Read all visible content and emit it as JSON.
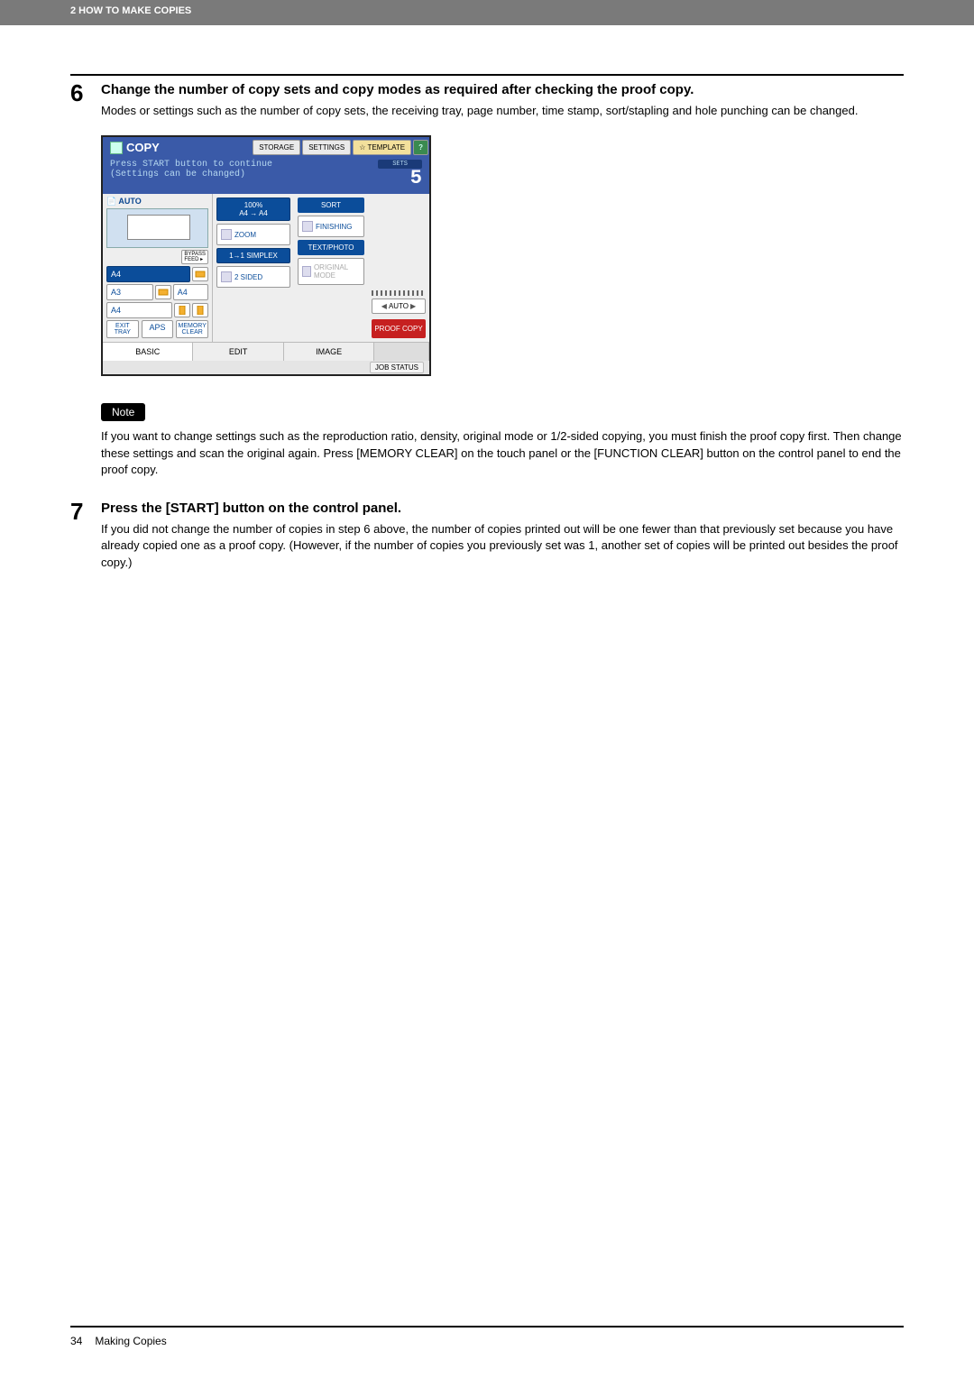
{
  "header": {
    "breadcrumb": "2 HOW TO MAKE COPIES"
  },
  "steps": [
    {
      "num": "6",
      "heading": "Change the number of copy sets and copy modes as required after checking the proof copy.",
      "text": "Modes or settings such as the number of copy sets, the receiving tray, page number, time stamp, sort/stapling and hole punching can be changed."
    },
    {
      "num": "7",
      "heading": "Press the [START] button on the control panel.",
      "text": "If you did not change the number of copies in step 6 above, the number of copies printed out will be one fewer than that previously set because you have already copied one as a proof copy. (However, if the number of copies you previously set was 1, another set of copies will be printed out besides the proof copy.)"
    }
  ],
  "copy_ui": {
    "title": "COPY",
    "top_buttons": {
      "storage": "STORAGE",
      "settings": "SETTINGS",
      "template": "TEMPLATE",
      "help": "?"
    },
    "msg_line1": "Press START button to continue",
    "msg_line2": "(Settings can be changed)",
    "sets_label": "SETS",
    "sets_value": "5",
    "left": {
      "auto": "AUTO",
      "bypass": "BYPASS FEED",
      "trays": [
        {
          "label": "A4",
          "selected": true,
          "orient": "landscape"
        },
        {
          "label": "A3",
          "selected": false,
          "orient": "landscape"
        },
        {
          "label": "A4",
          "selected": false,
          "orient": "portrait"
        }
      ],
      "right_col_label": "A4",
      "exit": "EXIT TRAY",
      "aps": "APS",
      "memory_clear": "MEMORY CLEAR"
    },
    "mid": {
      "ratio": "100%",
      "paper": "A4 → A4",
      "zoom": "ZOOM",
      "simplex": "1→1 SIMPLEX",
      "sided": "2 SIDED"
    },
    "right": {
      "sort": "SORT",
      "finishing": "FINISHING",
      "text_photo": "TEXT/PHOTO",
      "original_mode": "ORIGINAL MODE"
    },
    "far": {
      "auto": "AUTO",
      "proof": "PROOF COPY"
    },
    "tabs": {
      "basic": "BASIC",
      "edit": "EDIT",
      "image": "IMAGE"
    },
    "job_status": "JOB STATUS"
  },
  "note": {
    "badge": "Note",
    "text": "If you want to change settings such as the reproduction ratio, density, original mode or 1/2-sided copying, you must finish the proof copy first. Then change these settings and scan the original again. Press [MEMORY CLEAR] on the touch panel or the [FUNCTION CLEAR] button on the control panel to end the proof copy."
  },
  "footer": {
    "page": "34",
    "title": "Making Copies"
  }
}
